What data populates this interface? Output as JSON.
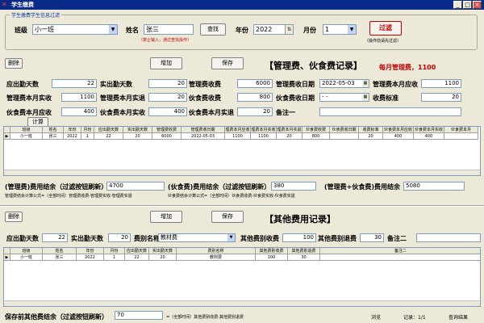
{
  "window": {
    "title": "学生缴费",
    "min": "_",
    "max": "□",
    "close": "×"
  },
  "filter": {
    "group_label": "学生缴费学生信息过滤",
    "class_label": "班级",
    "class_value": "小一班",
    "name_label": "姓名",
    "name_value": "张三",
    "search_btn": "查找",
    "warning": "（禁止输入，通过查找操作）",
    "year_label": "年份",
    "year_value": "2022",
    "month_label": "月份",
    "month_value": "1",
    "filter_btn": "过滤",
    "filter_note": "（操作前请先过滤）"
  },
  "mgmt": {
    "delete_btn": "删除",
    "add_btn": "增加",
    "save_btn": "保存",
    "header": "【管理费、伙食费记录】",
    "monthly_fee": "每月管理费，1100",
    "calc_btn": "计算",
    "fields": {
      "due_days_label": "应出勤天数",
      "due_days": "22",
      "actual_days_label": "实出勤天数",
      "actual_days": "20",
      "mgmt_fee_label": "管理费收费",
      "mgmt_fee": "6000",
      "mgmt_date_label": "管理费收日期",
      "mgmt_date": "2022-05-03",
      "mgmt_month_due_label": "管理费本月应收",
      "mgmt_month_due": "1100",
      "mgmt_month_actual_label": "管理费本月实收",
      "mgmt_month_actual": "1100",
      "mgmt_month_refund_label": "管理费本月实退",
      "mgmt_month_refund": "20",
      "meal_fee_label": "伙食费收费",
      "meal_fee": "800",
      "meal_date_label": "伙食费收日期",
      "meal_date": "- -",
      "fee_std_label": "收费标准",
      "fee_std": "20",
      "meal_month_due_label": "伙食费本月应收",
      "meal_month_due": "400",
      "meal_month_actual_label": "伙食费本月实收",
      "meal_month_actual": "400",
      "meal_month_refund_label": "伙食费本月实退",
      "meal_month_refund": "20",
      "remark1_label": "备注一",
      "remark1": ""
    },
    "grid": {
      "headers": [
        "班级",
        "姓名",
        "年份",
        "月份",
        "应出勤天数",
        "实出勤天数",
        "管理费收费",
        "管理费收日期",
        "理费本月应收",
        "理费本月实收",
        "理费本月实退",
        "伙食费收费",
        "伙食费收日期",
        "收费标准",
        "伙食费本月应收",
        "伙食费本月实收",
        "伙食费本月"
      ],
      "row": [
        "小一班",
        "张三",
        "2022",
        "1",
        "22",
        "20",
        "6000",
        "2022-05-03",
        "1100",
        "1100",
        "20",
        "800",
        "",
        "20",
        "400",
        "400",
        ""
      ]
    },
    "summary": {
      "mgmt_label": "(管理费)费用结余（过滤按钮刷新）",
      "mgmt_value": "4700",
      "mgmt_formula": "管理费结余计算公式=（全部时间）管理费收费-管理费实收-管理费实退",
      "meal_label": "(伙食费)费用结余（过滤按钮刷新）",
      "meal_value": "380",
      "meal_formula": "伙食费结余计算公式=（全部时间）伙食费收费-伙食费实收-伙食费实退",
      "total_label": "(管理费+伙食费)费用结余",
      "total_value": "5080"
    }
  },
  "other": {
    "delete_btn": "删除",
    "add_btn": "增加",
    "save_btn": "保存",
    "header": "【其他费用记录】",
    "fields": {
      "due_days_label": "应出勤天数",
      "due_days": "22",
      "actual_days_label": "实出勤天数",
      "actual_days": "20",
      "fee_name_label": "费别名称",
      "fee_name": "教材费",
      "other_fee_label": "其他费别收费",
      "other_fee": "100",
      "other_refund_label": "其他费别退费",
      "other_refund": "30",
      "remark2_label": "备注二",
      "remark2": ""
    },
    "grid": {
      "headers": [
        "班级",
        "姓名",
        "年份",
        "月份",
        "应出勤天数",
        "实出勤天数",
        "费别名称",
        "其他费别收费",
        "其他费别退费",
        "备注二"
      ],
      "row": [
        "小一班",
        "张三",
        "2022",
        "1",
        "22",
        "20",
        "教材费",
        "100",
        "30",
        ""
      ]
    }
  },
  "status": {
    "balance_label": "保存前其他费结余（过滤按钮刷新）",
    "balance_value": "70",
    "formula": "=（全部时间）其他费别收费-其他费别退费",
    "browse": "浏览",
    "record": "记录：1/1",
    "query": "查询结果"
  }
}
